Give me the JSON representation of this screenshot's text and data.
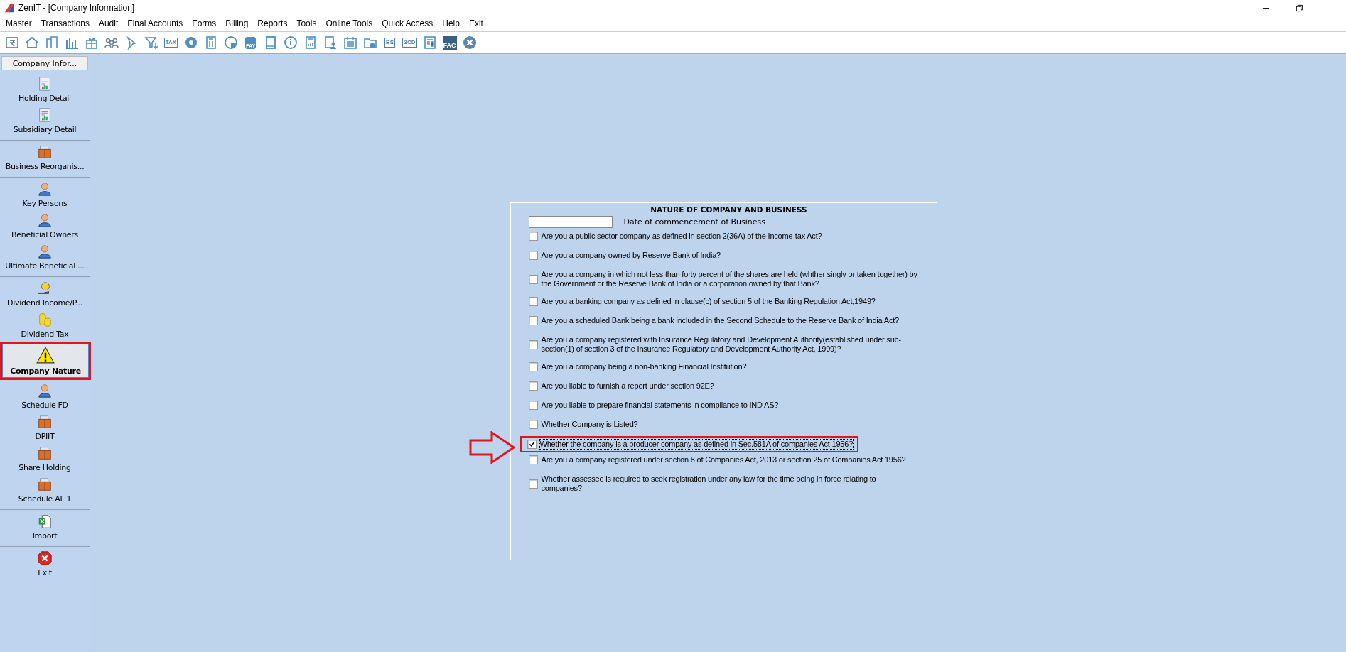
{
  "window": {
    "title": "ZenIT - [Company Information]"
  },
  "menu": [
    "Master",
    "Transactions",
    "Audit",
    "Final Accounts",
    "Forms",
    "Billing",
    "Reports",
    "Tools",
    "Online Tools",
    "Quick Access",
    "Help",
    "Exit"
  ],
  "toolbar": [
    {
      "kind": "rupee"
    },
    {
      "kind": "home"
    },
    {
      "kind": "building"
    },
    {
      "kind": "bars"
    },
    {
      "kind": "gift"
    },
    {
      "kind": "people"
    },
    {
      "kind": "pin"
    },
    {
      "kind": "filter"
    },
    {
      "kind": "tag",
      "label": "TAX"
    },
    {
      "kind": "disc"
    },
    {
      "kind": "calculator"
    },
    {
      "kind": "pie"
    },
    {
      "kind": "pay",
      "label": "PAY"
    },
    {
      "kind": "book"
    },
    {
      "kind": "info"
    },
    {
      "kind": "report"
    },
    {
      "kind": "user-doc"
    },
    {
      "kind": "calendar"
    },
    {
      "kind": "folder"
    },
    {
      "kind": "tag",
      "label": "BS"
    },
    {
      "kind": "tag",
      "label": "3CD"
    },
    {
      "kind": "sheet"
    },
    {
      "kind": "fac",
      "label": "FAC"
    },
    {
      "kind": "close"
    }
  ],
  "sidebar": {
    "header": "Company Infor...",
    "groups": [
      {
        "items": [
          {
            "label": "Holding Detail",
            "kind": "report",
            "selected": false,
            "highlighted": false
          },
          {
            "label": "Subsidiary Detail",
            "kind": "report",
            "selected": false,
            "highlighted": false
          }
        ]
      },
      {
        "items": [
          {
            "label": "Business Reorganis...",
            "kind": "folder",
            "selected": false,
            "highlighted": false
          }
        ]
      },
      {
        "items": [
          {
            "label": "Key Persons",
            "kind": "person",
            "selected": false,
            "highlighted": false
          },
          {
            "label": "Beneficial Owners",
            "kind": "person",
            "selected": false,
            "highlighted": false
          },
          {
            "label": "Ultimate Beneficial ...",
            "kind": "person",
            "selected": false,
            "highlighted": false
          }
        ]
      },
      {
        "items": [
          {
            "label": "Dividend Income/P...",
            "kind": "money",
            "selected": false,
            "highlighted": false
          },
          {
            "label": "Dividend Tax",
            "kind": "coins",
            "selected": false,
            "highlighted": false
          },
          {
            "label": "Company Nature",
            "kind": "warning",
            "selected": true,
            "highlighted": true
          },
          {
            "label": "Schedule FD",
            "kind": "person",
            "selected": false,
            "highlighted": false
          },
          {
            "label": "DPIIT",
            "kind": "folder",
            "selected": false,
            "highlighted": false
          },
          {
            "label": "Share Holding",
            "kind": "folder",
            "selected": false,
            "highlighted": false
          },
          {
            "label": "Schedule AL 1",
            "kind": "folder",
            "selected": false,
            "highlighted": false
          }
        ]
      },
      {
        "items": [
          {
            "label": "Import",
            "kind": "excel",
            "selected": false,
            "highlighted": false
          }
        ]
      },
      {
        "items": [
          {
            "label": "Exit",
            "kind": "exit",
            "selected": false,
            "highlighted": false
          }
        ]
      }
    ]
  },
  "form": {
    "title": "NATURE OF COMPANY AND BUSINESS",
    "date_label": "Date of commencement of Business",
    "questions": [
      {
        "text": "Are you a public sector company as defined in section 2(36A) of the Income-tax Act?",
        "checked": false,
        "highlighted": false
      },
      {
        "text": "Are you a company owned by Reserve Bank of India?",
        "checked": false,
        "highlighted": false
      },
      {
        "text": "Are you a company in which not less than forty percent of the shares are held (whther singly or taken together) by the Government or the Reserve Bank of India or a corporation owned by that Bank?",
        "checked": false,
        "highlighted": false
      },
      {
        "text": "Are you a banking company as defined in clause(c) of section 5 of the Banking Regulation Act,1949?",
        "checked": false,
        "highlighted": false
      },
      {
        "text": "Are you a scheduled Bank being a bank included in the Second Schedule to the Reserve Bank of India Act?",
        "checked": false,
        "highlighted": false
      },
      {
        "text": "Are you a company registered with Insurance Regulatory and Development Authority(established under sub-section(1) of section 3 of the Insurance Regulatory and Development Authority Act, 1999)?",
        "checked": false,
        "highlighted": false
      },
      {
        "text": "Are you a company being a non-banking Financial Institution?",
        "checked": false,
        "highlighted": false
      },
      {
        "text": "Are you liable to furnish a report under section 92E?",
        "checked": false,
        "highlighted": false
      },
      {
        "text": "Are you liable to prepare financial statements in compliance to IND AS?",
        "checked": false,
        "highlighted": false
      },
      {
        "text": "Whether Company is Listed?",
        "checked": false,
        "highlighted": false
      },
      {
        "text": "Whether the company is a producer company as defined in Sec.581A of companies Act 1956?",
        "checked": true,
        "highlighted": true
      },
      {
        "text": "Are you a company registered under section 8 of Companies Act, 2013 or section 25 of Companies Act 1956?",
        "checked": false,
        "highlighted": false
      },
      {
        "text": "Whether assessee is required to seek registration under any law for the time being in force relating to companies?",
        "checked": false,
        "highlighted": false
      }
    ]
  }
}
